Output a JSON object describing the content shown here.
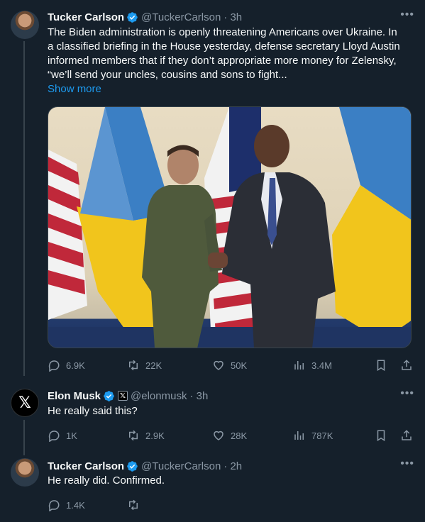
{
  "tweets": [
    {
      "name": "Tucker Carlson",
      "handle": "@TuckerCarlson",
      "time": "· 3h",
      "text_lines": [
        "The Biden administration is openly threatening Americans over Ukraine. In",
        "a classified briefing in the House yesterday, defense secretary Lloyd Austin",
        "informed members that if they don’t appropriate more money for Zelensky,",
        "“we’ll send your uncles, cousins and sons to fight..."
      ],
      "show_more": "Show more",
      "stats": {
        "replies": "6.9K",
        "reposts": "22K",
        "likes": "50K",
        "views": "3.4M"
      }
    },
    {
      "name": "Elon Musk",
      "badge_letter": "𝕏",
      "handle": "@elonmusk",
      "time": "· 3h",
      "text": "He really said this?",
      "stats": {
        "replies": "1K",
        "reposts": "2.9K",
        "likes": "28K",
        "views": "787K"
      }
    },
    {
      "name": "Tucker Carlson",
      "handle": "@TuckerCarlson",
      "time": "· 2h",
      "text": "He really did. Confirmed.",
      "stats": {
        "replies": "1.4K"
      }
    }
  ],
  "icons": {
    "more": "more-icon",
    "reply": "reply-icon",
    "repost": "repost-icon",
    "like": "like-icon",
    "views": "views-icon",
    "bookmark": "bookmark-icon",
    "share": "share-icon",
    "verified": "verified-badge-icon"
  },
  "colors": {
    "background": "#15202b",
    "text": "#f7f9f9",
    "secondary": "#8b98a5",
    "accent": "#1d9bf0",
    "thread_line": "#38444d"
  }
}
